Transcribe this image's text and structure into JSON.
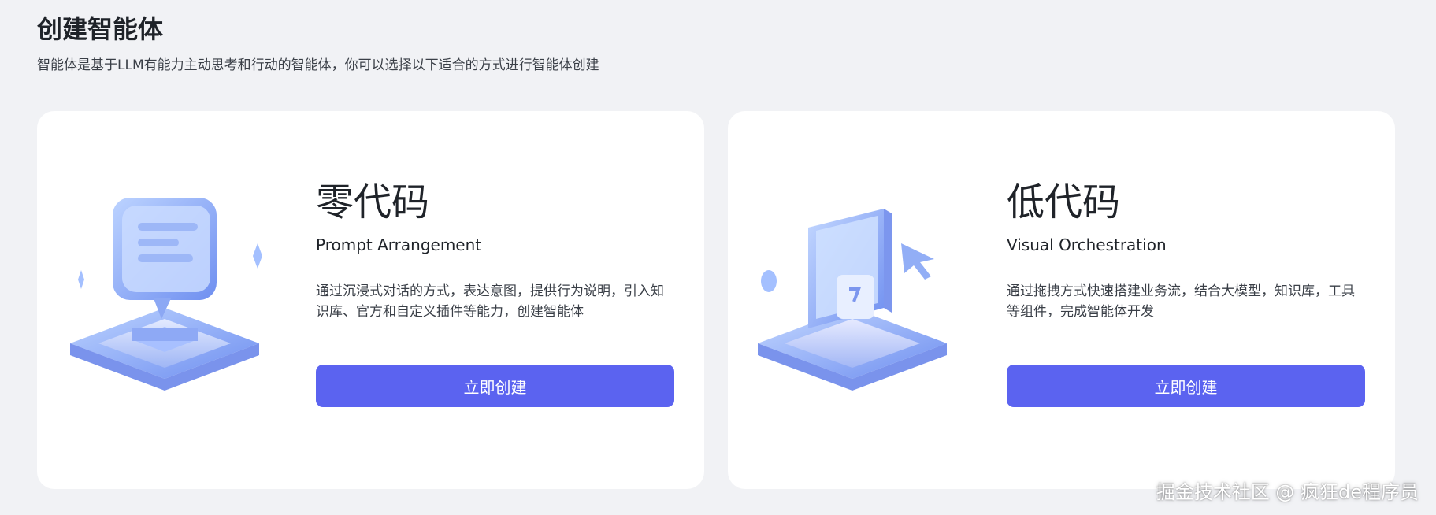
{
  "header": {
    "title": "创建智能体",
    "subtitle": "智能体是基于LLM有能力主动思考和行动的智能体，你可以选择以下适合的方式进行智能体创建"
  },
  "cards": [
    {
      "title": "零代码",
      "subtitle": "Prompt Arrangement",
      "description": "通过沉浸式对话的方式，表达意图，提供行为说明，引入知识库、官方和自定义插件等能力，创建智能体",
      "button": "立即创建",
      "icon": "chat-bubble-illustration"
    },
    {
      "title": "低代码",
      "subtitle": "Visual Orchestration",
      "description": "通过拖拽方式快速搭建业务流，结合大模型，知识库，工具等组件，完成智能体开发",
      "button": "立即创建",
      "icon": "drag-cursor-illustration"
    }
  ],
  "watermark": "掘金技术社区 @ 疯狂de程序员",
  "colors": {
    "accent": "#5b63f0",
    "background": "#f1f2f5",
    "card": "#ffffff",
    "illustration": "#8fb2f8"
  }
}
